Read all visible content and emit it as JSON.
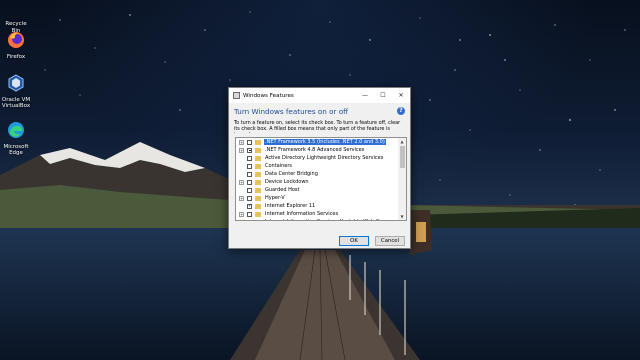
{
  "desktop": {
    "icons": [
      {
        "label": "Recycle Bin",
        "icon": "recycle-bin-icon"
      },
      {
        "label": "Firefox",
        "icon": "firefox-icon"
      },
      {
        "label": "Oracle VM VirtualBox",
        "icon": "virtualbox-icon"
      },
      {
        "label": "Microsoft Edge",
        "icon": "edge-icon"
      }
    ]
  },
  "dialog": {
    "title": "Windows Features",
    "heading": "Turn Windows features on or off",
    "description": "To turn a feature on, select its check box. To turn a feature off, clear its check box. A filled box means that only part of the feature is turned on.",
    "features": [
      {
        "label": ".NET Framework 3.5 (includes .NET 2.0 and 3.0)",
        "state": "unchecked",
        "expandable": true,
        "selected": true
      },
      {
        "label": ".NET Framework 4.8 Advanced Services",
        "state": "partial",
        "expandable": true,
        "selected": false
      },
      {
        "label": "Active Directory Lightweight Directory Services",
        "state": "unchecked",
        "expandable": false,
        "selected": false
      },
      {
        "label": "Containers",
        "state": "unchecked",
        "expandable": false,
        "selected": false
      },
      {
        "label": "Data Center Bridging",
        "state": "unchecked",
        "expandable": false,
        "selected": false
      },
      {
        "label": "Device Lockdown",
        "state": "unchecked",
        "expandable": true,
        "selected": false
      },
      {
        "label": "Guarded Host",
        "state": "unchecked",
        "expandable": false,
        "selected": false
      },
      {
        "label": "Hyper-V",
        "state": "unchecked",
        "expandable": true,
        "selected": false
      },
      {
        "label": "Internet Explorer 11",
        "state": "checked",
        "expandable": false,
        "selected": false
      },
      {
        "label": "Internet Information Services",
        "state": "unchecked",
        "expandable": true,
        "selected": false
      },
      {
        "label": "Internet Information Services Hostable Web Core",
        "state": "unchecked",
        "expandable": false,
        "selected": false
      },
      {
        "label": "Legacy Components",
        "state": "unchecked",
        "expandable": true,
        "selected": false
      }
    ],
    "ok_label": "OK",
    "cancel_label": "Cancel",
    "help_glyph": "?"
  },
  "colors": {
    "heading": "#1e4c9a",
    "selection": "#2f6fd1",
    "folder": "#e9c35a"
  }
}
